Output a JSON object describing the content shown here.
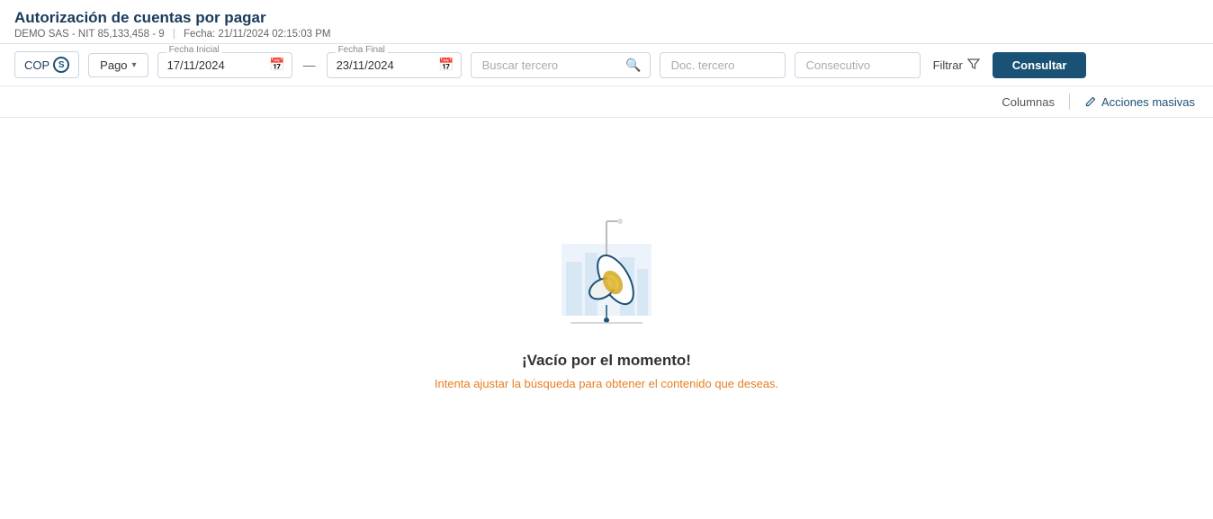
{
  "header": {
    "title": "Autorización de cuentas por pagar",
    "company": "DEMO SAS - NIT 85,133,458 - 9",
    "date_label": "Fecha: 21/11/2024 02:15:03 PM"
  },
  "toolbar": {
    "currency": "COP",
    "currency_icon": "S",
    "type_label": "Pago",
    "fecha_inicial_label": "Fecha Inicial",
    "fecha_inicial_value": "17/11/2024",
    "fecha_final_label": "Fecha Final",
    "fecha_final_value": "23/11/2024",
    "buscar_placeholder": "Buscar tercero",
    "doc_placeholder": "Doc. tercero",
    "consecutivo_placeholder": "Consecutivo",
    "filtrar_label": "Filtrar",
    "consultar_label": "Consultar"
  },
  "actions_bar": {
    "columns_label": "Columnas",
    "acciones_label": "Acciones masivas"
  },
  "empty_state": {
    "title": "¡Vacío por el momento!",
    "subtitle": "Intenta ajustar la búsqueda para obtener el contenido que deseas."
  }
}
